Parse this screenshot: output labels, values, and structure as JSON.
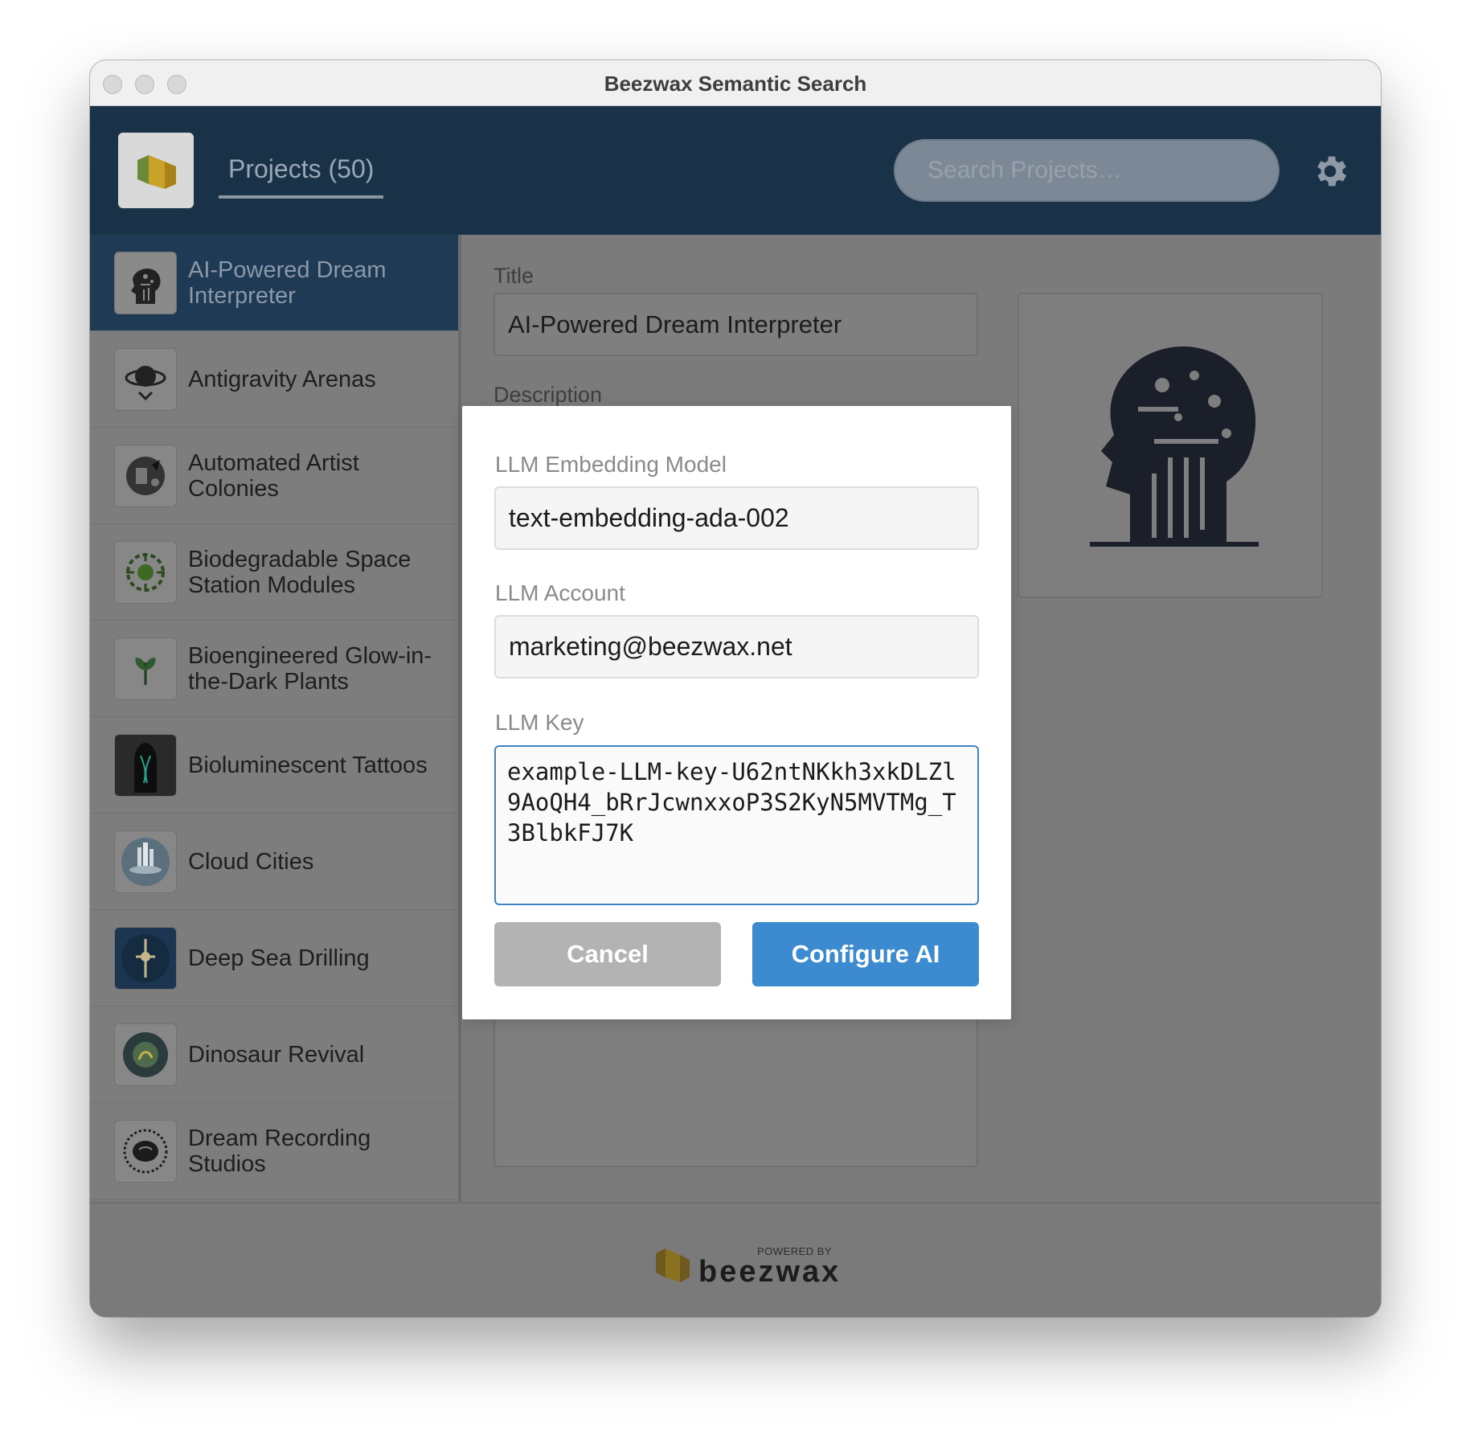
{
  "window": {
    "title": "Beezwax Semantic Search"
  },
  "header": {
    "projects_tab": "Projects (50)",
    "search_placeholder": "Search Projects…"
  },
  "sidebar": {
    "items": [
      {
        "label": "AI-Powered Dream Interpreter",
        "selected": true,
        "icon": "brain-circuit-icon"
      },
      {
        "label": "Antigravity Arenas",
        "selected": false,
        "icon": "planet-arena-icon"
      },
      {
        "label": "Automated Artist Colonies",
        "selected": false,
        "icon": "robot-palette-icon"
      },
      {
        "label": "Biodegradable Space Station Modules",
        "selected": false,
        "icon": "leaf-station-icon"
      },
      {
        "label": "Bioengineered Glow-in-the-Dark Plants",
        "selected": false,
        "icon": "glow-plant-icon"
      },
      {
        "label": "Bioluminescent Tattoos",
        "selected": false,
        "icon": "tattooed-back-icon"
      },
      {
        "label": "Cloud Cities",
        "selected": false,
        "icon": "floating-city-icon"
      },
      {
        "label": "Deep Sea Drilling",
        "selected": false,
        "icon": "deep-sea-rig-icon"
      },
      {
        "label": "Dinosaur Revival",
        "selected": false,
        "icon": "dna-dinosaur-icon"
      },
      {
        "label": "Dream Recording Studios",
        "selected": false,
        "icon": "dream-brain-icon"
      }
    ]
  },
  "detail": {
    "title_label": "Title",
    "title_value": "AI-Powered Dream Interpreter",
    "description_label": "Description"
  },
  "modal": {
    "model_label": "LLM Embedding Model",
    "model_value": "text-embedding-ada-002",
    "account_label": "LLM Account",
    "account_value": "marketing@beezwax.net",
    "key_label": "LLM Key",
    "key_value": "example-LLM-key-U62ntNKkh3xkDLZl9AoQH4_bRrJcwnxxoP3S2KyN5MVTMg_T3BlbkFJ7K",
    "cancel_label": "Cancel",
    "configure_label": "Configure AI"
  },
  "footer": {
    "powered_by": "POWERED BY",
    "brand": "beezwax"
  },
  "colors": {
    "header_bg": "#1a3248",
    "selected_item_bg": "#1f3a55",
    "primary_button": "#3c8bd0",
    "cancel_button": "#b3b3b3",
    "overlay": "#7a7a7a"
  }
}
